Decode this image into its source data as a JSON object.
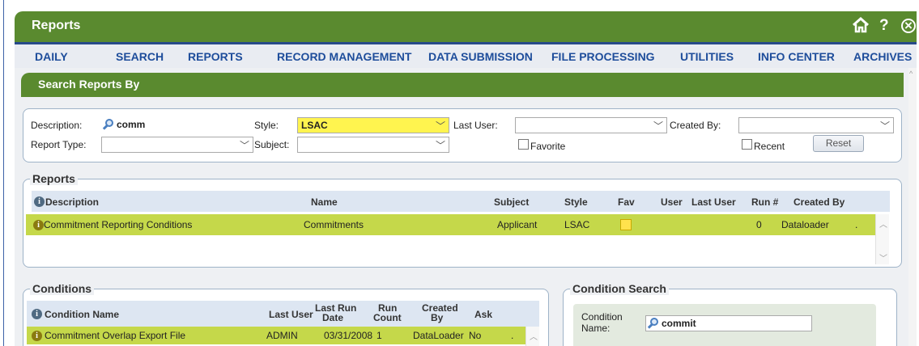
{
  "window": {
    "title": "Reports"
  },
  "header_icons": [
    "home-icon",
    "help-icon",
    "close-icon"
  ],
  "nav": [
    "DAILY",
    "SEARCH",
    "REPORTS",
    "RECORD MANAGEMENT",
    "DATA SUBMISSION",
    "FILE PROCESSING",
    "UTILITIES",
    "INFO CENTER",
    "ARCHIVES"
  ],
  "search_section": {
    "title": "Search Reports By"
  },
  "filters": {
    "description_label": "Description:",
    "description_value": "comm",
    "style_label": "Style:",
    "style_value": "LSAC",
    "last_user_label": "Last User:",
    "last_user_value": "",
    "created_by_label": "Created By:",
    "created_by_value": "",
    "report_type_label": "Report Type:",
    "report_type_value": "",
    "subject_label": "Subject:",
    "subject_value": "",
    "favorite_label": "Favorite",
    "recent_label": "Recent",
    "reset_label": "Reset"
  },
  "reports": {
    "legend": "Reports",
    "headers": [
      "Description",
      "Name",
      "Subject",
      "Style",
      "Fav",
      "User",
      "Last User",
      "Run #",
      "Created By"
    ],
    "row": {
      "description": "Commitment Reporting Conditions",
      "name": "Commitments",
      "subject": "Applicant",
      "style": "LSAC",
      "run": "0",
      "created_by": "Dataloader",
      "trail": "."
    }
  },
  "conditions": {
    "legend": "Conditions",
    "headers": {
      "name": "Condition Name",
      "last_user": "Last User",
      "last_run_1": "Last Run",
      "last_run_2": "Date",
      "run_count_1": "Run",
      "run_count_2": "Count",
      "created_1": "Created",
      "created_2": "By",
      "ask": "Ask"
    },
    "row": {
      "name": "Commitment Overlap Export File",
      "last_user": "ADMIN",
      "date": "03/31/2008",
      "count": "1",
      "created_by": "DataLoader",
      "ask": "No",
      "trail": "."
    }
  },
  "condition_search": {
    "legend": "Condition Search",
    "label_1": "Condition",
    "label_2": "Name:",
    "value": "commit"
  },
  "colors": {
    "green": "#5a8a2f",
    "nav_text": "#1e4d9b",
    "row_highlight": "#c5d84a",
    "style_highlight": "#fff44f"
  }
}
